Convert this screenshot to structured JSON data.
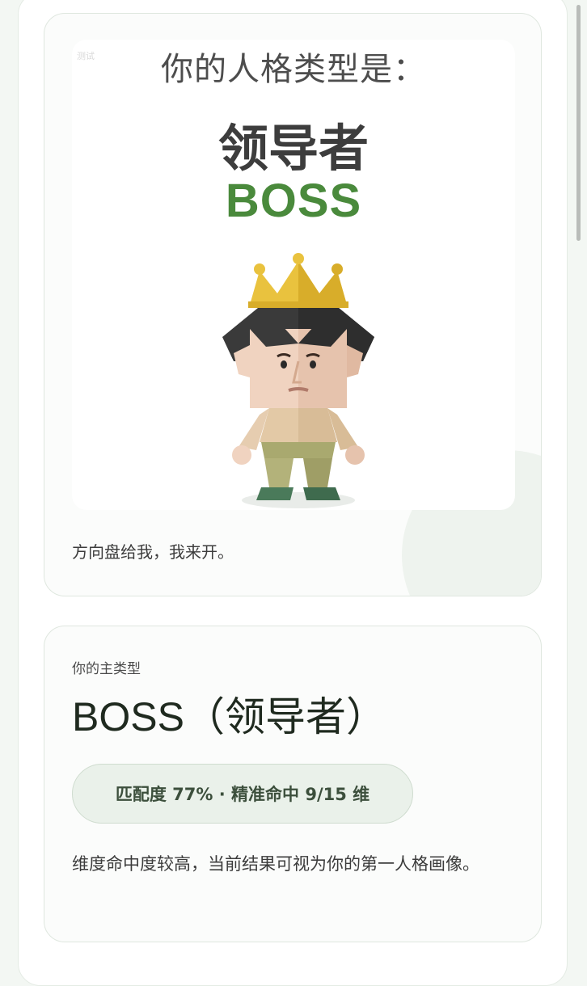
{
  "result_card": {
    "poster": {
      "watermark": "测试",
      "heading": "你的人格类型是：",
      "type_name": "领导者",
      "type_code": "BOSS",
      "figure_icon": "boss-character-with-crown"
    },
    "tagline": "方向盘给我，我来开。"
  },
  "summary_card": {
    "label": "你的主类型",
    "main_type": "BOSS（领导者）",
    "match_text": "匹配度 77% · 精准命中 9/15 维",
    "match_percent": 77,
    "dimensions_hit": 9,
    "dimensions_total": 15,
    "description": "维度命中度较高，当前结果可视为你的第一人格画像。"
  },
  "colors": {
    "accent_green": "#4a8a3c",
    "pill_bg": "#eaf1ea"
  }
}
